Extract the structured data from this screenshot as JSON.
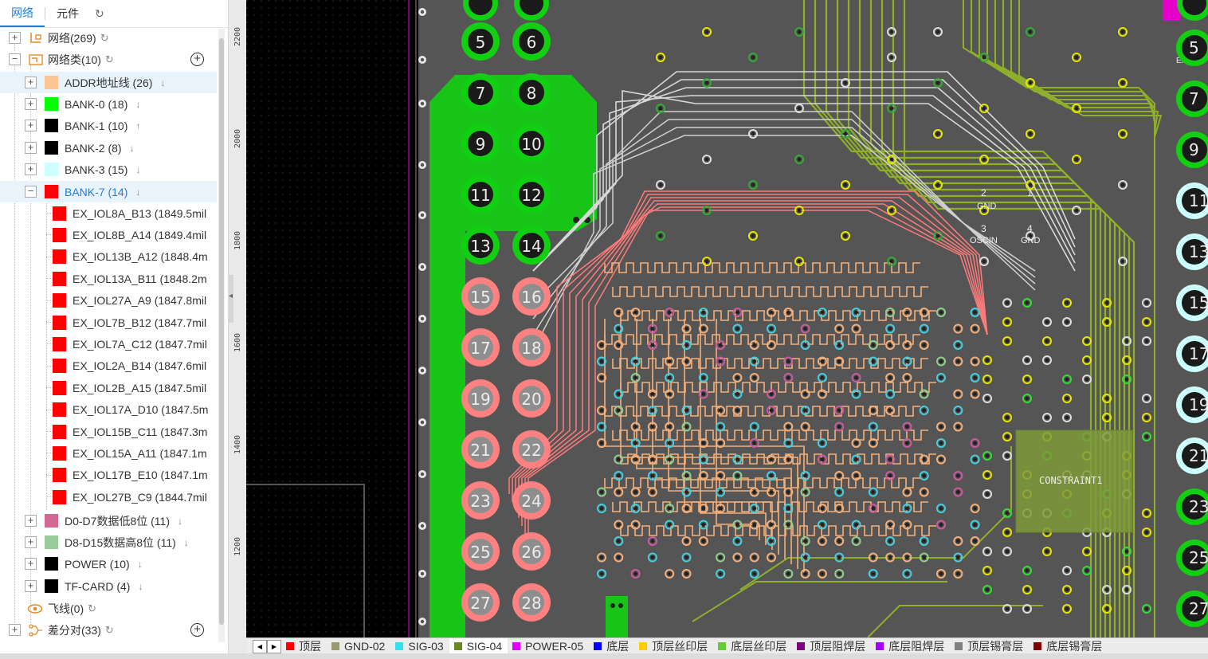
{
  "panel": {
    "tabs": [
      "网络",
      "元件"
    ],
    "active_tab": "网络",
    "refresh_icon": "refresh-icon"
  },
  "tree": {
    "nets": {
      "label": "网络(269)"
    },
    "net_classes": {
      "label": "网络类(10)"
    },
    "classes": [
      {
        "label": "ADDR地址线 (26)",
        "color": "#fcc591",
        "expanded": false,
        "arrow": "↓"
      },
      {
        "label": "BANK-0 (18)",
        "color": "#00ff00",
        "expanded": false,
        "arrow": "↓"
      },
      {
        "label": "BANK-1 (10)",
        "color": "#000000",
        "expanded": false,
        "arrow": "↑"
      },
      {
        "label": "BANK-2 (8)",
        "color": "#000000",
        "expanded": false,
        "arrow": "↓"
      },
      {
        "label": "BANK-3 (15)",
        "color": "#ccffff",
        "expanded": false,
        "arrow": "↓"
      },
      {
        "label": "BANK-7 (14)",
        "color": "#ff0000",
        "expanded": true,
        "arrow": "↓"
      }
    ],
    "bank7_nets": [
      "EX_IOL8A_B13 (1849.5mil",
      "EX_IOL8B_A14 (1849.4mil",
      "EX_IOL13B_A12 (1848.4m",
      "EX_IOL13A_B11 (1848.2m",
      "EX_IOL27A_A9 (1847.8mil",
      "EX_IOL7B_B12 (1847.7mil",
      "EX_IOL7A_C12 (1847.7mil",
      "EX_IOL2A_B14 (1847.6mil",
      "EX_IOL2B_A15 (1847.5mil",
      "EX_IOL17A_D10 (1847.5m",
      "EX_IOL15B_C11 (1847.3m",
      "EX_IOL15A_A11 (1847.1m",
      "EX_IOL17B_E10 (1847.1m",
      "EX_IOL27B_C9 (1844.7mil"
    ],
    "more_classes": [
      {
        "label": "D0-D7数据低8位 (11)",
        "color": "#d46895",
        "arrow": "↓"
      },
      {
        "label": "D8-D15数据高8位 (11)",
        "color": "#99cc99",
        "arrow": "↓"
      },
      {
        "label": "POWER (10)",
        "color": "#000000",
        "arrow": "↓"
      },
      {
        "label": "TF-CARD (4)",
        "color": "#000000",
        "arrow": "↓"
      }
    ],
    "ratsnest": {
      "label": "飞线(0)"
    },
    "diff_pairs": {
      "label": "差分对(33)"
    }
  },
  "ruler": {
    "ticks": [
      "2200",
      "2000",
      "1800",
      "1600",
      "1400",
      "1200"
    ]
  },
  "pcb": {
    "pads_left": [
      "5",
      "6",
      "7",
      "8",
      "9",
      "10",
      "11",
      "12",
      "13",
      "14",
      "15",
      "16",
      "17",
      "18",
      "19",
      "20",
      "21",
      "22",
      "23",
      "24",
      "25",
      "26",
      "27",
      "28"
    ],
    "pads_right": [
      "5",
      "7",
      "9",
      "11",
      "13",
      "15",
      "17",
      "19",
      "21",
      "23",
      "25",
      "27"
    ],
    "labels": {
      "gnd": "GND",
      "pin2": "2",
      "pin1": "1",
      "pin3": "3",
      "pin4": "4",
      "oscin": "OSCIN",
      "constraint": "CONSTRAINT1",
      "ex_pb": "EX_PB"
    }
  },
  "layers": [
    {
      "name": "顶层",
      "color": "#ff0000"
    },
    {
      "name": "GND-02",
      "color": "#9a9a6f"
    },
    {
      "name": "SIG-03",
      "color": "#33e0f0"
    },
    {
      "name": "SIG-04",
      "color": "#6a8a1f",
      "active": true
    },
    {
      "name": "POWER-05",
      "color": "#e400ff"
    },
    {
      "name": "底层",
      "color": "#0000ff"
    },
    {
      "name": "顶层丝印层",
      "color": "#ffcc00"
    },
    {
      "name": "底层丝印层",
      "color": "#66cc33"
    },
    {
      "name": "顶层阻焊层",
      "color": "#800080"
    },
    {
      "name": "底层阻焊层",
      "color": "#aa00ff"
    },
    {
      "name": "顶层锡膏层",
      "color": "#808080"
    },
    {
      "name": "底层锡膏层",
      "color": "#800000"
    }
  ]
}
